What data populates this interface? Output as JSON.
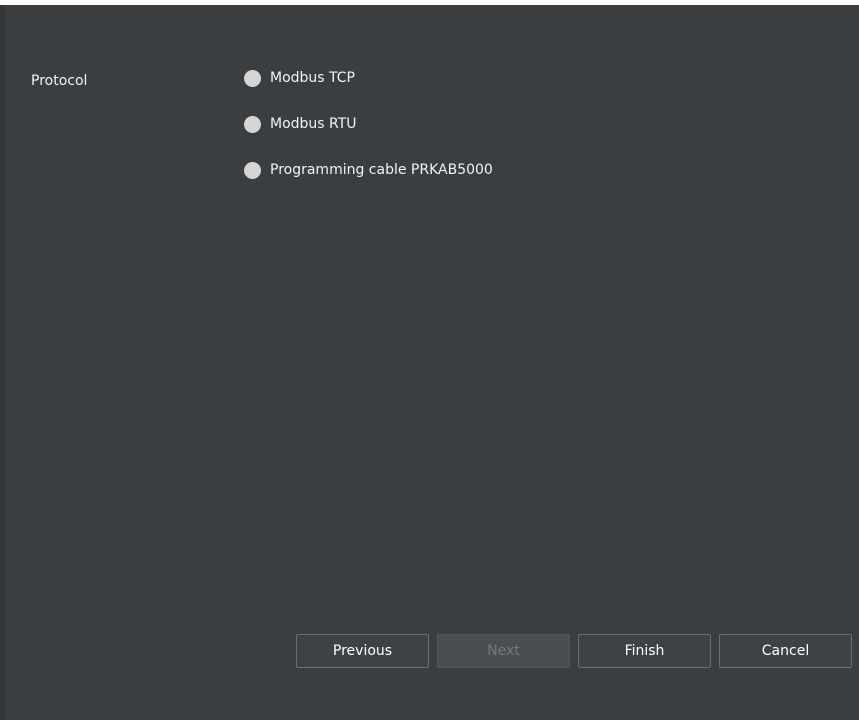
{
  "protocol": {
    "label": "Protocol",
    "options": [
      {
        "label": "Modbus TCP",
        "selected": false
      },
      {
        "label": "Modbus RTU",
        "selected": false
      },
      {
        "label": "Programming cable PRKAB5000",
        "selected": false
      }
    ]
  },
  "buttons": {
    "previous": "Previous",
    "next": "Next",
    "finish": "Finish",
    "cancel": "Cancel"
  },
  "colors": {
    "background": "#3b3e41",
    "radio_fill": "#d5d5d5",
    "disabled_text": "#75787b"
  }
}
